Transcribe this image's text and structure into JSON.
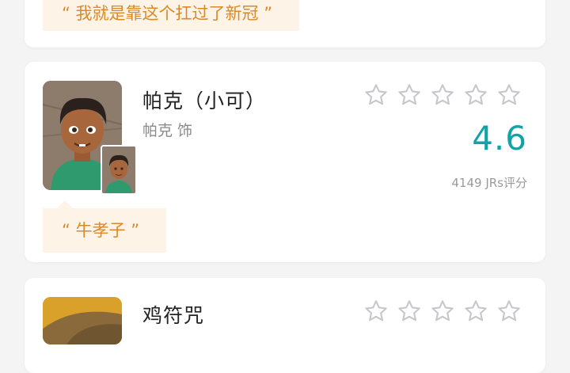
{
  "top_card": {
    "quote": "“ 我就是靠这个扛过了新冠 ”"
  },
  "main_card": {
    "character_name": "帕克（小可）",
    "actor": "帕克 饰",
    "score": "4.6",
    "votes": "4149 JRs评分",
    "quote": "“ 牛孝子 ”",
    "star_count": 5
  },
  "bottom_card": {
    "character_name": "鸡符咒",
    "star_count": 5
  },
  "colors": {
    "score": "#11a3a8",
    "quote_text": "#d98a2b",
    "quote_bg": "#fdf3e7",
    "star_outline": "#c8c8cc"
  }
}
